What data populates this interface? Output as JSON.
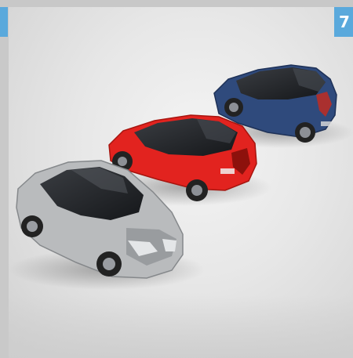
{
  "page_badge": {
    "text": "7"
  },
  "cars": [
    {
      "id": "blue",
      "color_body": "#2f4a7c",
      "color_shade": "#1e3157"
    },
    {
      "id": "red",
      "color_body": "#e2231f",
      "color_shade": "#a7150f"
    },
    {
      "id": "silver",
      "color_body": "#b9bbbd",
      "color_shade": "#85888b"
    }
  ],
  "colors": {
    "accent": "#5aa9dc",
    "background": "#e6e6e6"
  }
}
